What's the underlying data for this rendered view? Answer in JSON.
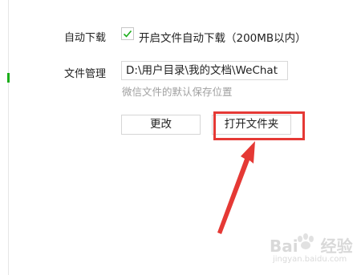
{
  "settings": {
    "auto_download": {
      "label": "自动下载",
      "checkbox_text": "开启文件自动下载（200MB以内）",
      "checked": true
    },
    "file_management": {
      "label": "文件管理",
      "path_value": "D:\\用户目录\\我的文档\\WeChat",
      "hint": "微信文件的默认保存位置"
    },
    "buttons": {
      "change": "更改",
      "open_folder": "打开文件夹"
    }
  },
  "annotation": {
    "highlight_color": "#e53935",
    "check_color": "#1aad19"
  },
  "watermark": {
    "brand": "Bai",
    "brand_cn": "经验",
    "url": "jingyan.baidu.com"
  }
}
